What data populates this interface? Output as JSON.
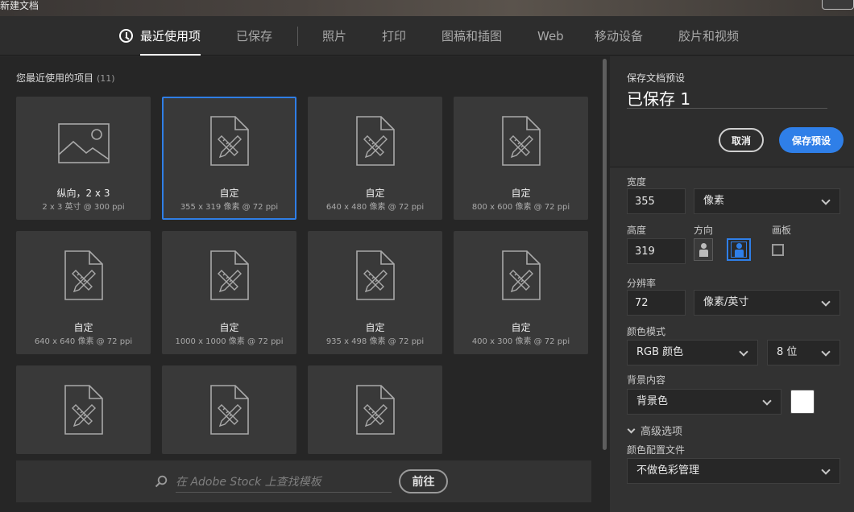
{
  "window": {
    "title": "新建文档"
  },
  "tabs": [
    {
      "label": "最近使用项",
      "active": true,
      "icon": "clock-icon"
    },
    {
      "label": "已保存",
      "active": false
    },
    {
      "label": "照片",
      "active": false
    },
    {
      "label": "打印",
      "active": false
    },
    {
      "label": "图稿和插图",
      "active": false
    },
    {
      "label": "Web",
      "active": false
    },
    {
      "label": "移动设备",
      "active": false
    },
    {
      "label": "胶片和视频",
      "active": false
    }
  ],
  "recent": {
    "title": "您最近使用的项目",
    "count": "(11)",
    "items": [
      {
        "name": "纵向，2 x 3",
        "dims": "2 x 3 英寸 @ 300 ppi",
        "icon": "image-icon"
      },
      {
        "name": "自定",
        "dims": "355 x 319 像素 @ 72 ppi",
        "icon": "document-icon",
        "selected": true
      },
      {
        "name": "自定",
        "dims": "640 x 480 像素 @ 72 ppi",
        "icon": "document-icon"
      },
      {
        "name": "自定",
        "dims": "800 x 600 像素 @ 72 ppi",
        "icon": "document-icon"
      },
      {
        "name": "自定",
        "dims": "640 x 640 像素 @ 72 ppi",
        "icon": "document-icon"
      },
      {
        "name": "自定",
        "dims": "1000 x 1000 像素 @ 72 ppi",
        "icon": "document-icon"
      },
      {
        "name": "自定",
        "dims": "935 x 498 像素 @ 72 ppi",
        "icon": "document-icon"
      },
      {
        "name": "自定",
        "dims": "400 x 300 像素 @ 72 ppi",
        "icon": "document-icon"
      },
      {
        "name": "",
        "dims": "",
        "icon": "document-icon"
      },
      {
        "name": "",
        "dims": "",
        "icon": "document-icon"
      },
      {
        "name": "",
        "dims": "",
        "icon": "document-icon"
      }
    ]
  },
  "stock": {
    "placeholder": "在 Adobe Stock 上查找模板",
    "go_label": "前往"
  },
  "preset": {
    "label": "保存文档预设",
    "name": "已保存 1",
    "cancel_label": "取消",
    "save_label": "保存预设"
  },
  "settings": {
    "width_label": "宽度",
    "width_value": "355",
    "width_unit": "像素",
    "height_label": "高度",
    "height_value": "319",
    "orientation_label": "方向",
    "orientation": "landscape",
    "artboard_label": "画板",
    "artboard_checked": false,
    "resolution_label": "分辨率",
    "resolution_value": "72",
    "resolution_unit": "像素/英寸",
    "color_mode_label": "颜色模式",
    "color_mode": "RGB 颜色",
    "bit_depth": "8 位",
    "background_label": "背景内容",
    "background": "背景色",
    "background_color": "#ffffff",
    "advanced_label": "高级选项",
    "color_profile_label": "颜色配置文件",
    "color_profile": "不做色彩管理"
  },
  "colors": {
    "accent": "#2f7fe8",
    "panel": "#262626",
    "card": "#393939"
  }
}
